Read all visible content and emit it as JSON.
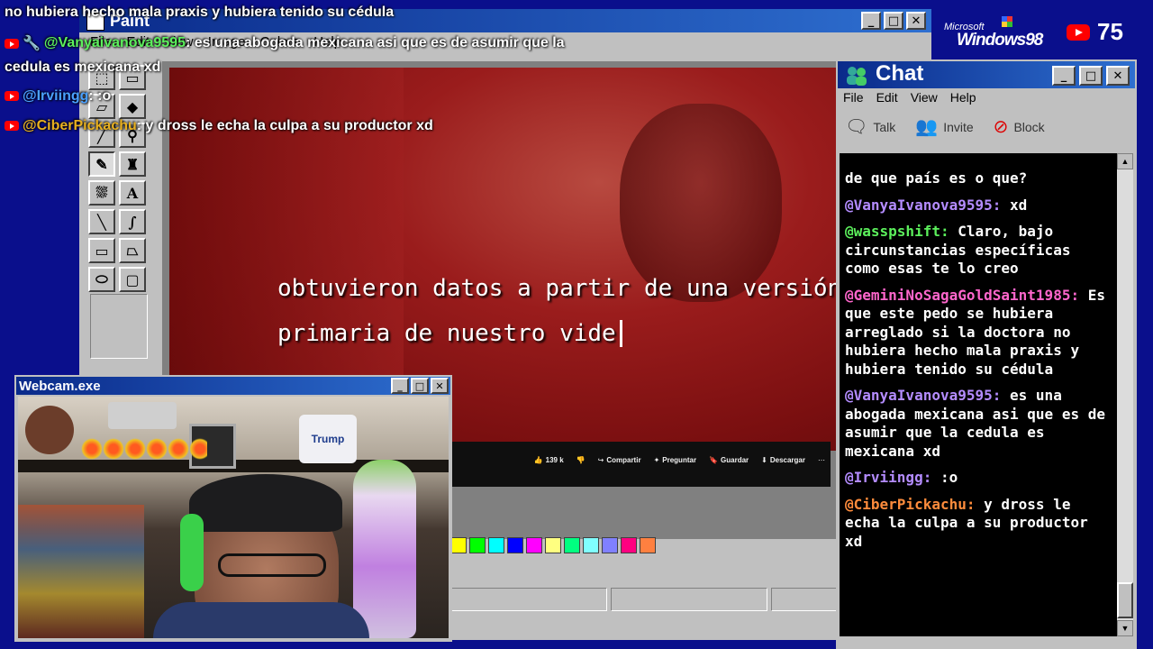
{
  "paint": {
    "title": "Paint",
    "menu": [
      "File",
      "Edit",
      "View",
      "Image",
      "Colors",
      "Help"
    ],
    "tools": [
      "free-select",
      "select",
      "eraser",
      "fill",
      "picker",
      "magnifier",
      "pencil",
      "brush",
      "airbrush",
      "text",
      "line",
      "curve",
      "rectangle",
      "polygon",
      "ellipse",
      "rounded-rect"
    ],
    "palette": [
      "#ffff00",
      "#00ff00",
      "#00ffff",
      "#0000ff",
      "#ff00ff",
      "#ffff80",
      "#00ff80",
      "#80ffff",
      "#8080ff",
      "#ff0080",
      "#ff8040"
    ]
  },
  "video": {
    "subtitle_line1": "obtuvieron datos a partir de una versión",
    "subtitle_line2": "primaria de nuestro vide",
    "actions": {
      "likes": "139 k",
      "share": "Compartir",
      "ask": "Preguntar",
      "save": "Guardar",
      "download": "Descargar",
      "more": "⋯"
    }
  },
  "top_right": {
    "microsoft": "Microsoft",
    "windows": "Windows98",
    "viewer_count": "75"
  },
  "overlay_chat": [
    {
      "user": "",
      "text": "no hubiera hecho mala praxis y hubiera tenido su cédula"
    },
    {
      "user": "@Vanyaivanova9595",
      "text": ": es una abogada mexicana asi que es de asumir que la"
    },
    {
      "user": "",
      "text": "cedula es mexicana xd"
    },
    {
      "user": "@Irviingg",
      "text": ": :o"
    },
    {
      "user": "@CiberPickachu",
      "text": ": y dross le echa la culpa a su productor xd"
    }
  ],
  "chat": {
    "title": "Chat",
    "menu": [
      "File",
      "Edit",
      "View",
      "Help"
    ],
    "toolbar": {
      "talk": "Talk",
      "invite": "Invite",
      "block": "Block"
    },
    "messages": [
      {
        "user": "",
        "color": "#ffffff",
        "text": "de que país es o que?"
      },
      {
        "user": "@VanyaIvanova9595:",
        "color": "#b48cff",
        "text": " xd"
      },
      {
        "user": "@wasspshift:",
        "color": "#5cf05c",
        "text": " Claro, bajo circunstancias específicas como esas te lo creo"
      },
      {
        "user": "@GeminiNoSagaGoldSaint1985:",
        "color": "#ff66cc",
        "text": " Es que este pedo se hubiera arreglado si la doctora no hubiera hecho mala praxis y hubiera tenido su cédula"
      },
      {
        "user": "@VanyaIvanova9595:",
        "color": "#b48cff",
        "text": " es una abogada mexicana asi que es de asumir que la cedula es mexicana xd"
      },
      {
        "user": "@Irviingg:",
        "color": "#b48cff",
        "text": " :o"
      },
      {
        "user": "@CiberPickachu:",
        "color": "#ff8c3c",
        "text": " y dross le echa la culpa a su productor xd"
      }
    ]
  },
  "webcam": {
    "title": "Webcam.exe",
    "trump_label": "Trump"
  },
  "colors": {
    "desktop": "#0a0f8c",
    "overlay_user_vanya": "#5cf05c",
    "overlay_user_irvi": "#4aa0ff",
    "overlay_user_ciber": "#e8b020"
  }
}
